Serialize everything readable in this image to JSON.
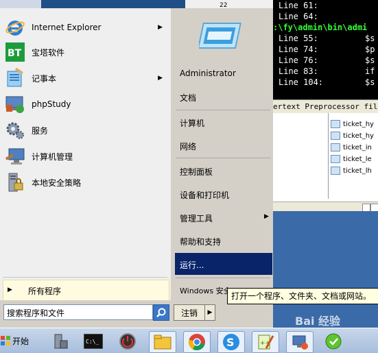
{
  "background": {
    "code_lines": [
      {
        "key": "Line 61:",
        "val": ""
      },
      {
        "key": "Line 64:",
        "val": ""
      },
      {
        "key": "",
        "val": ""
      },
      {
        "key": "Line 55:",
        "val": "$s"
      },
      {
        "key": "Line 74:",
        "val": "$p"
      },
      {
        "key": "Line 76:",
        "val": "$s"
      },
      {
        "key": "Line 83:",
        "val": "if"
      },
      {
        "key": "Line 104:",
        "val": "$s"
      }
    ],
    "path_text": ":\\fy\\admin\\bin\\admi",
    "status_text": "ertext Preprocessor file",
    "files": [
      "ticket_hy",
      "ticket_hy",
      "ticket_in",
      "ticket_le",
      "ticket_lh"
    ],
    "tab_number": "22"
  },
  "start_menu": {
    "programs": [
      {
        "label": "Internet Explorer",
        "icon": "internet-explorer-icon",
        "has_arrow": true
      },
      {
        "label": "宝塔软件",
        "icon": "bt-panel-icon",
        "has_arrow": false
      },
      {
        "label": "记事本",
        "icon": "notepad-icon",
        "has_arrow": true
      },
      {
        "label": "phpStudy",
        "icon": "phpstudy-icon",
        "has_arrow": false
      },
      {
        "label": "服务",
        "icon": "services-gear-icon",
        "has_arrow": false
      },
      {
        "label": "计算机管理",
        "icon": "computer-management-icon",
        "has_arrow": false
      },
      {
        "label": "本地安全策略",
        "icon": "security-policy-icon",
        "has_arrow": false
      }
    ],
    "all_programs": "所有程序",
    "search_placeholder": "搜索程序和文件",
    "right_items": {
      "administrator": "Administrator",
      "documents": "文档",
      "computer": "计算机",
      "network": "网络",
      "control_panel": "控制面板",
      "devices_printers": "设备和打印机",
      "admin_tools": "管理工具",
      "help": "帮助和支持",
      "run": "运行...",
      "windows_security": "Windows 安全"
    },
    "logoff": "注销",
    "tooltip": "打开一个程序、文件夹、文档或网站。"
  },
  "taskbar": {
    "start_label": "开始",
    "apps": [
      "server-manager-icon",
      "cmd-icon",
      "power-icon",
      "explorer-icon",
      "chrome-icon",
      "sogou-icon",
      "notepadpp-icon",
      "network-icon",
      "green-app-icon"
    ]
  },
  "watermark": "Bai 经验"
}
